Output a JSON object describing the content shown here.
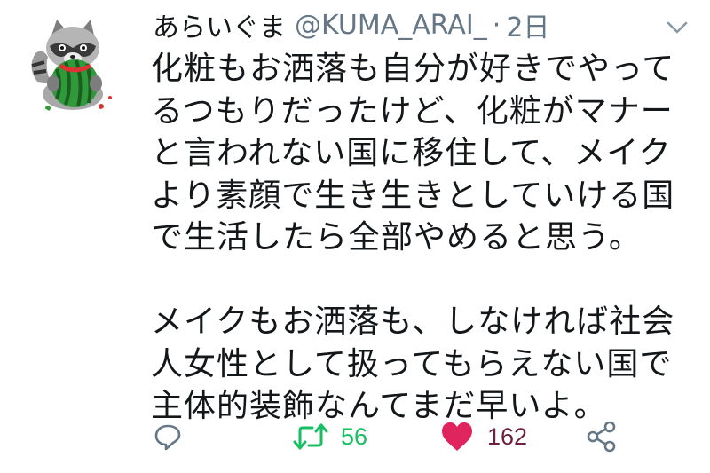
{
  "tweet": {
    "display_name": "あらいぐま",
    "handle": "@KUMA_ARAI_",
    "separator": "·",
    "time": "2日",
    "avatar_icon": "raccoon-eating-watermelon-avatar",
    "text": "化粧もお洒落も自分が好きでやってるつもりだったけど、化粧がマナーと言われない国に移住して、メイクより素顔で生き生きとしていける国で生活したら全部やめると思う。\n\nメイクもお洒落も、しなければ社会人女性として扱ってもらえない国で主体的装飾なんてまだ早いよ。"
  },
  "actions": {
    "reply": {
      "icon": "reply-icon"
    },
    "retweet": {
      "icon": "retweet-icon",
      "count": "56",
      "color": "#17bf63"
    },
    "like": {
      "icon": "heart-icon",
      "count": "162",
      "color": "#e0245e"
    },
    "share": {
      "icon": "share-icon"
    }
  },
  "menu": {
    "icon": "chevron-down-icon"
  }
}
